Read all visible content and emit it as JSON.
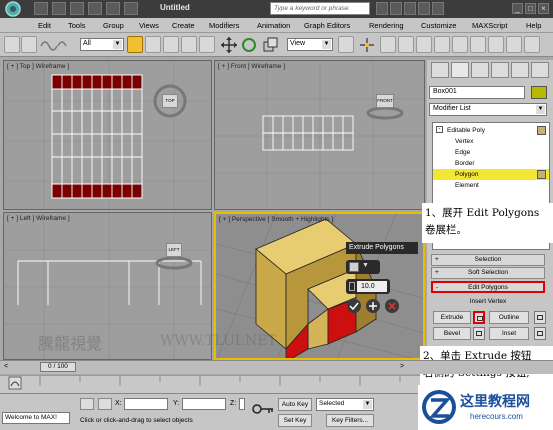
{
  "title_bar": {
    "title": "Untitled",
    "search_placeholder": "Type a keyword or phrase"
  },
  "menu": [
    "Edit",
    "Tools",
    "Group",
    "Views",
    "Create",
    "Modifiers",
    "Animation",
    "Graph Editors",
    "Rendering",
    "Customize",
    "MAXScript",
    "Help"
  ],
  "toolbar": {
    "selection_filter": "All",
    "ref_coord": "View"
  },
  "viewports": {
    "top": "[ + ] Top ] Wireframe ]",
    "front": "[ + ] Front ] Wireframe ]",
    "left": "[ + ] Left ] Wireframe ]",
    "perspective": "[ + ] Perspective ] Smooth + Highlights ]",
    "viewcube": {
      "top": "TOP",
      "front": "FRONT",
      "left": "LEFT"
    }
  },
  "caddy": {
    "title": "Extrude Polygons",
    "value": "10.0"
  },
  "command_panel": {
    "object_name": "Box001",
    "modifier_list": "Modifier List",
    "stack": {
      "root": "Editable Poly",
      "items": [
        "Vertex",
        "Edge",
        "Border",
        "Polygon",
        "Element"
      ],
      "selected": "Polygon"
    },
    "rollouts": {
      "selection": "Selection",
      "soft_selection": "Soft Selection",
      "edit_polygons": "Edit Polygons"
    },
    "buttons": {
      "insert_vertex": "Insert Vertex",
      "extrude": "Extrude",
      "outline": "Outline",
      "bevel": "Bevel",
      "inset": "Inset"
    }
  },
  "callouts": {
    "step1_line1": "1、展开 Edit Polygons",
    "step1_line2": "卷展栏。",
    "step2_line1": "2、单击 Extrude 按钮",
    "step2_line2": "右侧的 Settings 按钮,"
  },
  "timeline": {
    "frame": "0 / 100"
  },
  "status": {
    "maxscript": "Welcome to MAX!",
    "prompt": "Click or click-and-drag to select objects",
    "x_label": "X:",
    "y_label": "Y:",
    "z_label": "Z:",
    "auto_key": "Auto Key",
    "set_key": "Set Key",
    "key_mode": "Selected",
    "key_filters": "Key Filters..."
  },
  "watermarks": {
    "site_cn": "这里教程网",
    "site_url": "herecours.com",
    "vp_cn": "騰龍視覺",
    "vp_url": "WWW.TLUI.NET"
  },
  "colors": {
    "selected_poly": "#7a0000",
    "highlight": "#f2e833",
    "annotation": "#e00000",
    "caddy_bg": "#2a2a2a"
  }
}
